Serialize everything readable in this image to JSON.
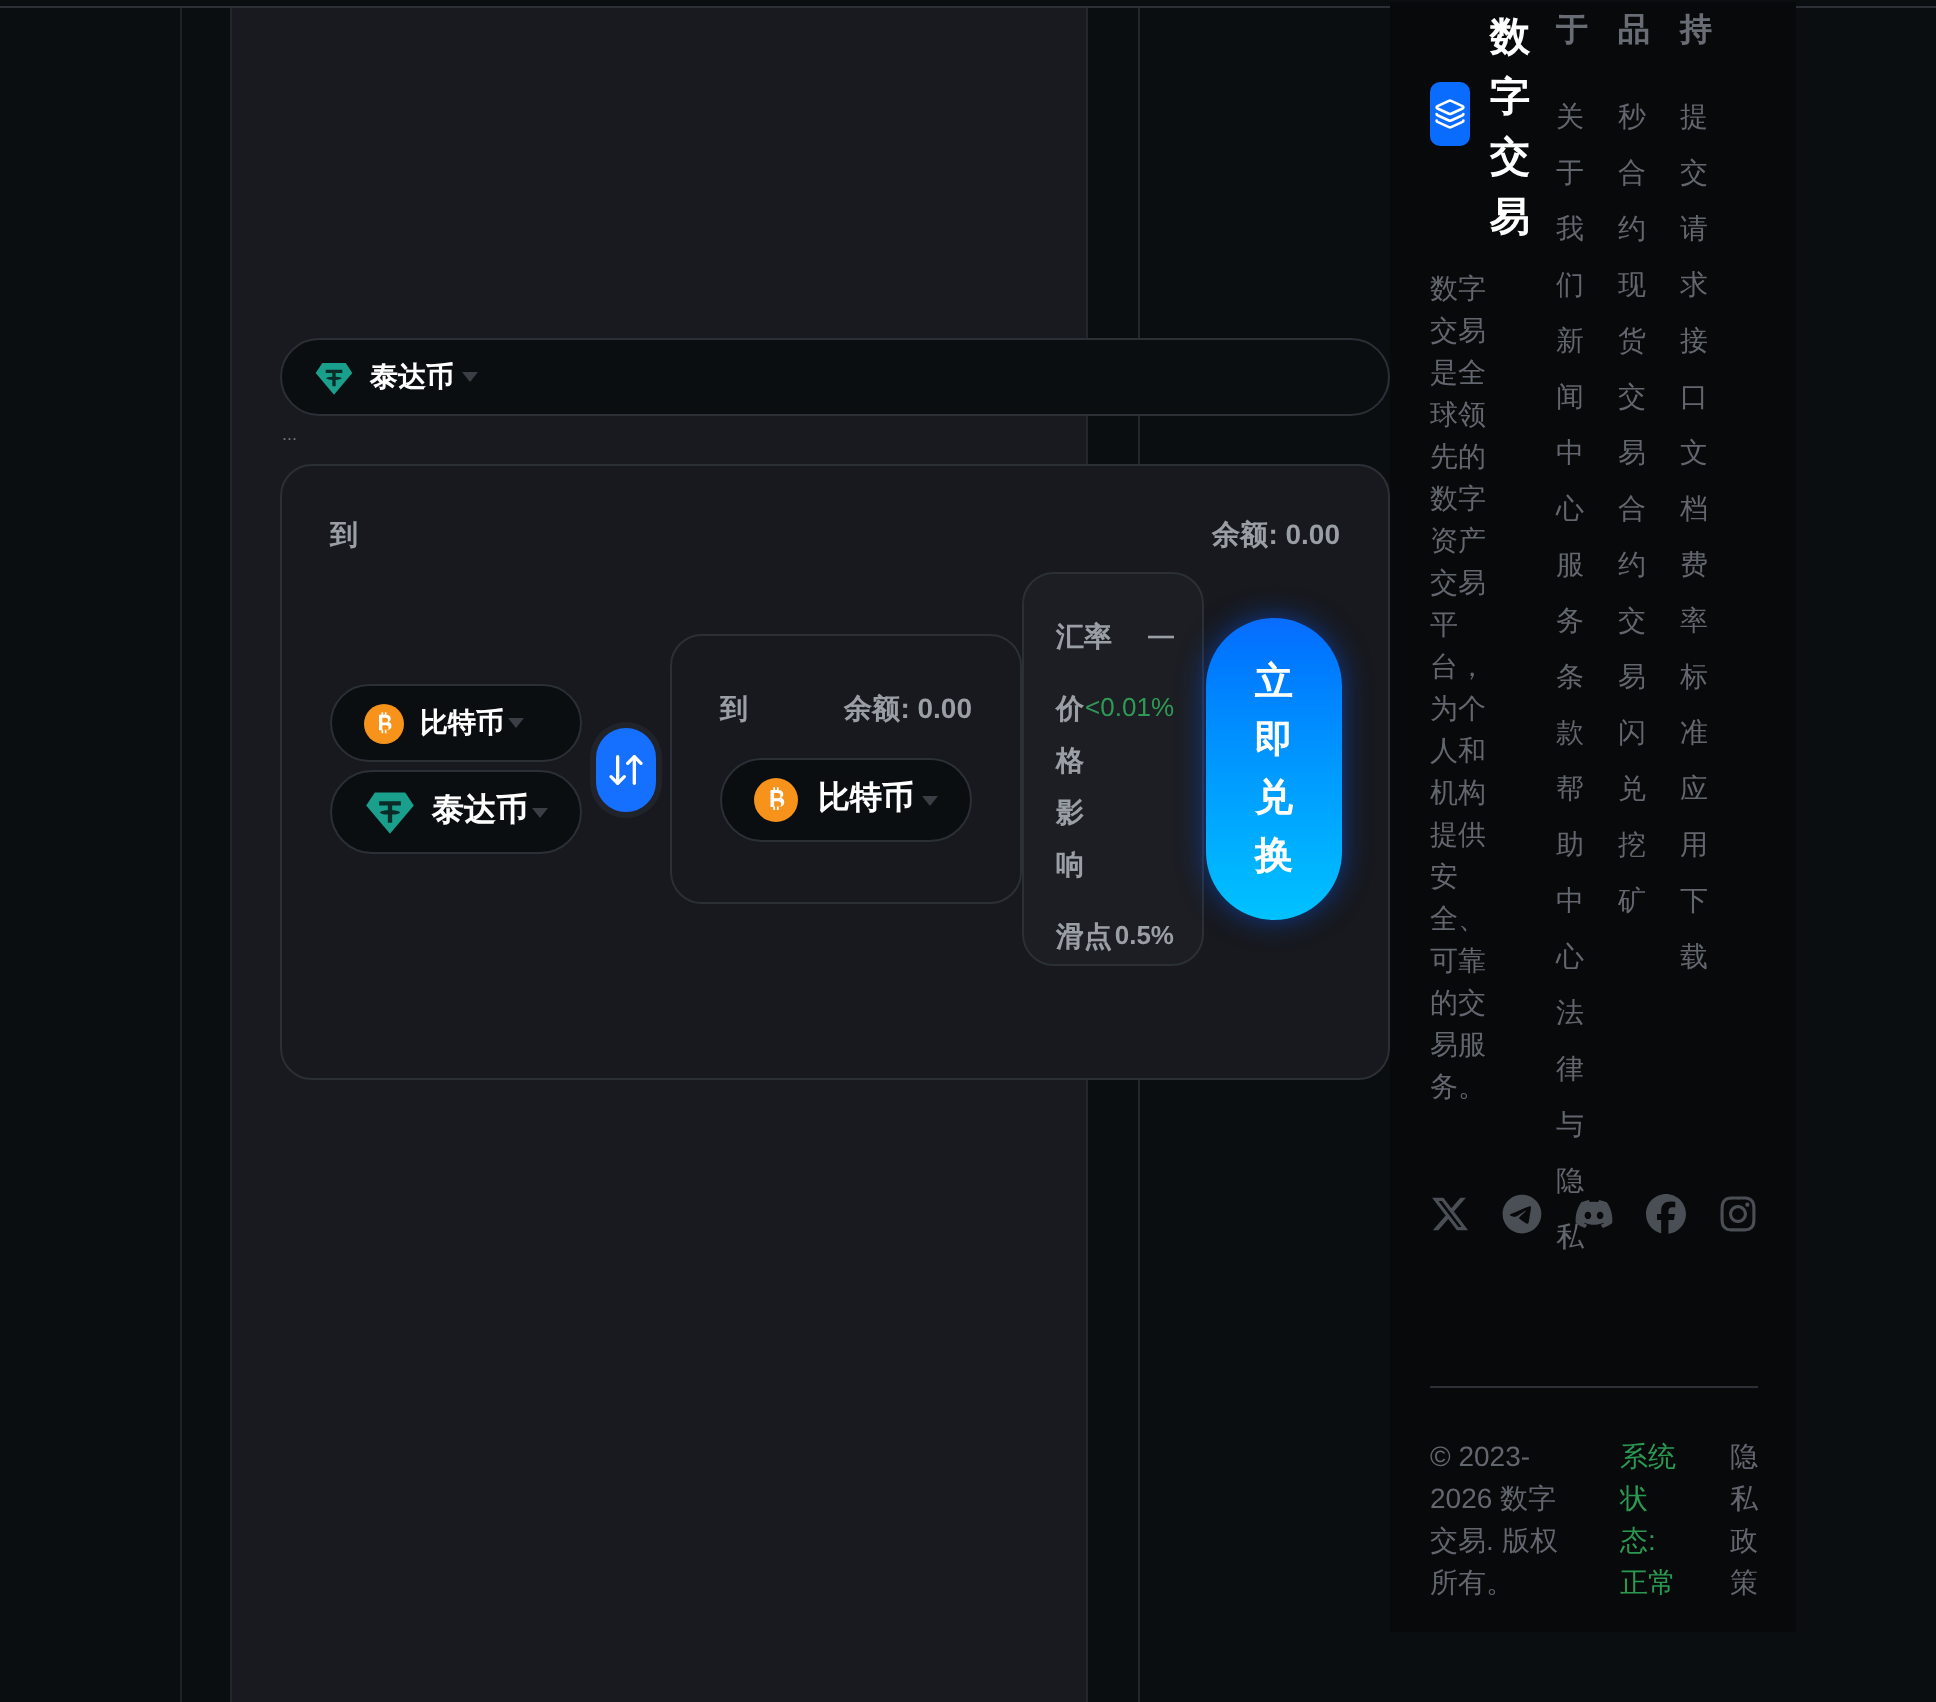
{
  "swap": {
    "from_token": {
      "symbol": "泰达币",
      "kind": "tether"
    },
    "dots": "...",
    "card": {
      "to_label": "到",
      "balance": "余额: 0.00",
      "tokens": [
        {
          "symbol": "比特币",
          "kind": "bitcoin"
        },
        {
          "symbol": "泰达币",
          "kind": "tether"
        }
      ],
      "target": {
        "to_label": "到",
        "balance": "余额: 0.00",
        "token": {
          "symbol": "比特币",
          "kind": "bitcoin"
        }
      },
      "rates": [
        {
          "label": "汇率",
          "value": "—",
          "kind": "neutral"
        },
        {
          "label": "价格影响",
          "value": "<0.01%",
          "kind": "positive"
        },
        {
          "label": "滑点",
          "value": "0.5%",
          "kind": "neutral"
        }
      ],
      "submit": "立即兑换"
    }
  },
  "footer": {
    "brand": "数字交易",
    "description": "数字交易是全球领先的数字资产交易平台，为个人和机构提供安全、可靠的交易服务。",
    "columns": [
      {
        "heading": "于",
        "links": [
          "关于我们",
          "新闻中心",
          "服务条款",
          "帮助中心",
          "法律与隐私"
        ]
      },
      {
        "heading": "品",
        "links": [
          "秒合约",
          "现货交易",
          "合约交易",
          "闪兑",
          "挖矿"
        ]
      },
      {
        "heading": "持",
        "links": [
          "提交请求",
          "接口文档",
          "费率标准",
          "应用下载"
        ]
      }
    ],
    "copyright": "© 2023-2026 数字交易. 版权所有。",
    "status": "系统状态: 正常",
    "privacy": "隐私政策"
  }
}
